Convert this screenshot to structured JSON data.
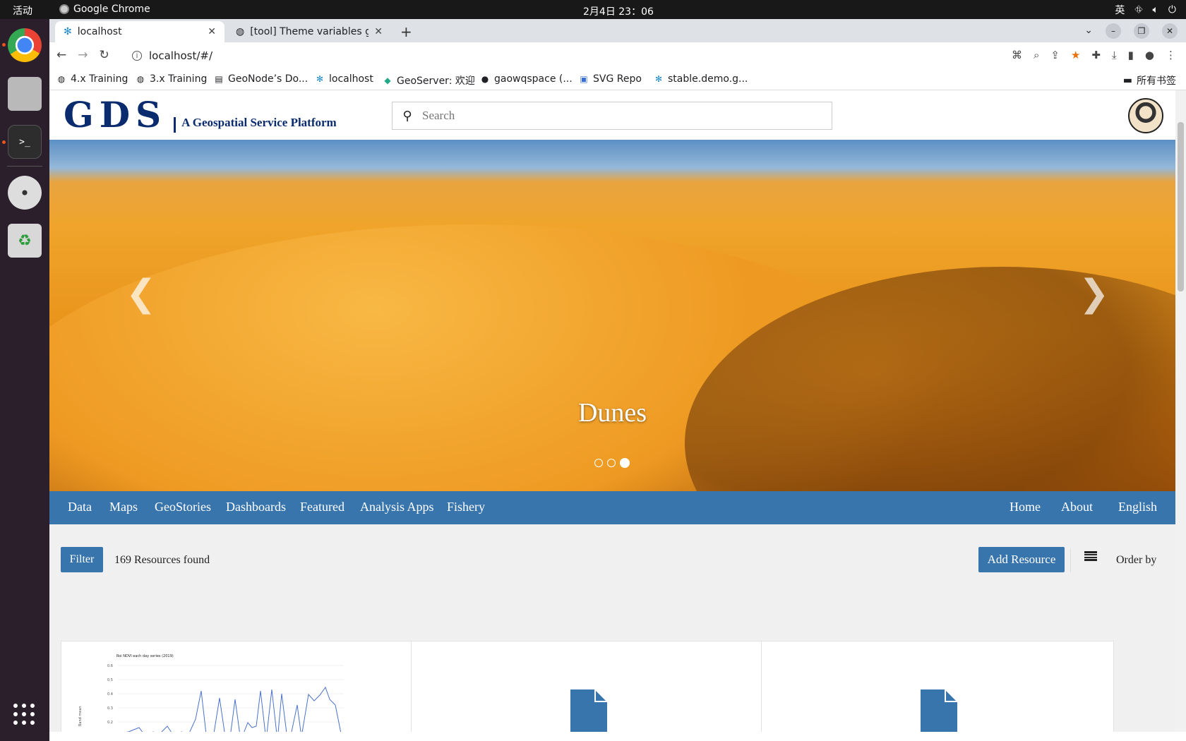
{
  "os": {
    "activities": "活动",
    "app_name": "Google Chrome",
    "clock": "2月4日 23：06",
    "ime": "英"
  },
  "browser": {
    "tabs": [
      {
        "title": "localhost",
        "active": true
      },
      {
        "title": "[tool] Theme variables ge",
        "active": false
      }
    ],
    "url": "localhost/#/",
    "bookmarks": [
      {
        "label": "4.x Training",
        "icon": "globe-icon"
      },
      {
        "label": "3.x Training",
        "icon": "globe-icon"
      },
      {
        "label": "GeoNode’s Do...",
        "icon": "doc-icon"
      },
      {
        "label": "localhost",
        "icon": "snowflake-icon"
      },
      {
        "label": "GeoServer: 欢迎",
        "icon": "geoserver-icon"
      },
      {
        "label": "gaowqspace (...",
        "icon": "github-icon"
      },
      {
        "label": "SVG Repo",
        "icon": "svgrepo-icon"
      },
      {
        "label": "stable.demo.g...",
        "icon": "snowflake-icon"
      }
    ],
    "all_bookmarks": "所有书签"
  },
  "header": {
    "logo_big": "GDS",
    "logo_sub": "A Geospatial Service Platform",
    "search_placeholder": "Search"
  },
  "hero": {
    "caption": "Dunes",
    "slide_count": 3,
    "active_slide": 3
  },
  "nav": {
    "left": [
      "Data",
      "Maps",
      "GeoStories",
      "Dashboards",
      "Featured",
      "Analysis Apps",
      "Fishery"
    ],
    "right": [
      "Home",
      "About",
      "English"
    ]
  },
  "resources": {
    "filter_label": "Filter",
    "count_text": "169 Resources found",
    "add_label": "Add Resource",
    "order_label": "Order by"
  },
  "cards": [
    {
      "type": "chart",
      "chart_title": "Roi NDVI each day series (2019)",
      "ylabel": "Band mean",
      "yticks": [
        "0.6",
        "0.5",
        "0.4",
        "0.3",
        "0.2"
      ]
    },
    {
      "type": "document"
    },
    {
      "type": "document"
    }
  ],
  "colors": {
    "primary": "#3975ad",
    "logo": "#0a2b6e"
  }
}
